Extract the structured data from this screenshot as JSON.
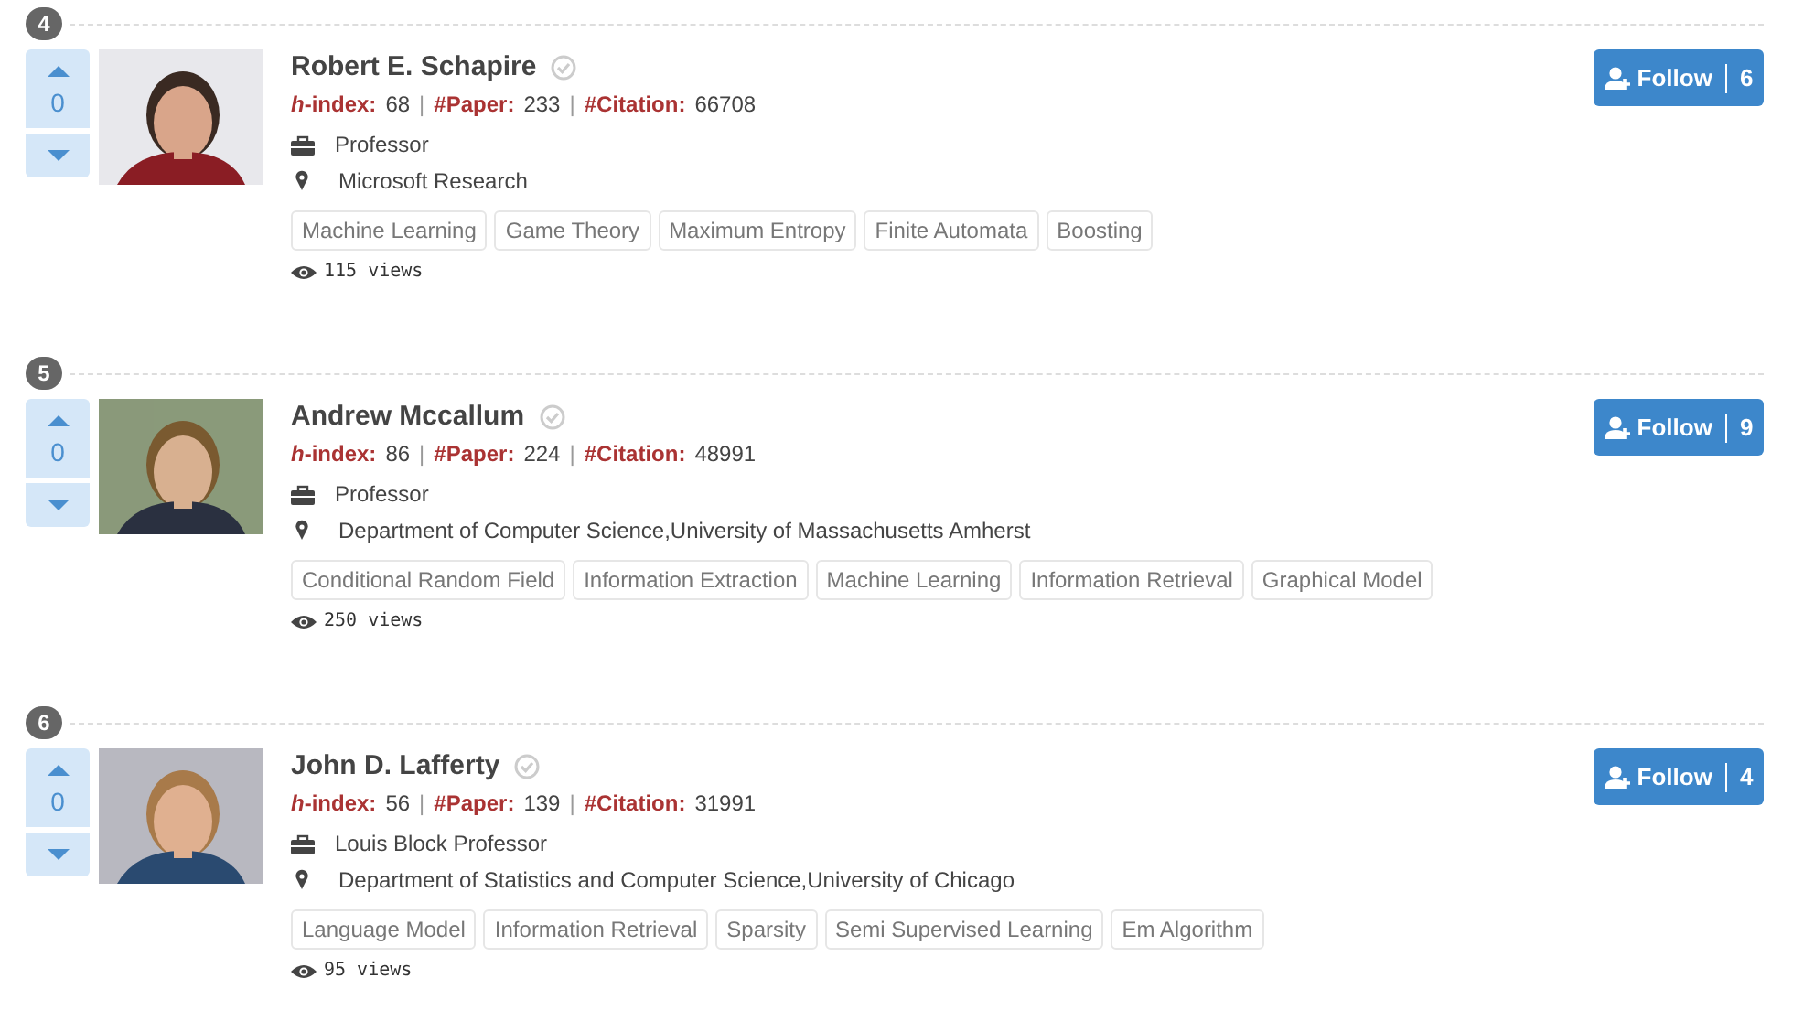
{
  "experts": [
    {
      "rank": "4",
      "votes": "0",
      "name": "Robert E. Schapire",
      "verified": true,
      "stats": [
        {
          "label": "*h*-index:",
          "value": "68"
        },
        {
          "separator": "|",
          "label": "#Paper:",
          "value": "233"
        },
        {
          "separator": "|",
          "label": "#Citation:",
          "value": "66708"
        }
      ],
      "position": "Professor",
      "affiliation": "Microsoft Research",
      "tags": [
        "Machine Learning",
        "Game Theory",
        "Maximum Entropy",
        "Finite Automata",
        "Boosting"
      ],
      "views": "115 views",
      "follow": {
        "label": "Follow",
        "count": "6"
      }
    },
    {
      "rank": "5",
      "votes": "0",
      "name": "Andrew Mccallum",
      "verified": true,
      "stats": [
        {
          "label": "*h*-index:",
          "value": "86"
        },
        {
          "separator": "|",
          "label": "#Paper:",
          "value": "224"
        },
        {
          "separator": "|",
          "label": "#Citation:",
          "value": "48991"
        }
      ],
      "position": "Professor",
      "affiliation": "Department of Computer Science,University of Massachusetts Amherst",
      "tags": [
        "Conditional Random Field",
        "Information Extraction",
        "Machine Learning",
        "Information Retrieval",
        "Graphical Model"
      ],
      "views": "250 views",
      "follow": {
        "label": "Follow",
        "count": "9"
      }
    },
    {
      "rank": "6",
      "votes": "0",
      "name": "John D. Lafferty",
      "verified": true,
      "stats": [
        {
          "label": "*h*-index:",
          "value": "56"
        },
        {
          "separator": "|",
          "label": "#Paper:",
          "value": "139"
        },
        {
          "separator": "|",
          "label": "#Citation:",
          "value": "31991"
        }
      ],
      "position": "Louis Block Professor",
      "affiliation": "Department of Statistics and Computer Science,University of Chicago",
      "tags": [
        "Language Model",
        "Information Retrieval",
        "Sparsity",
        "Semi Supervised Learning",
        "Em Algorithm"
      ],
      "views": "95 views",
      "follow": {
        "label": "Follow",
        "count": "4"
      }
    }
  ]
}
